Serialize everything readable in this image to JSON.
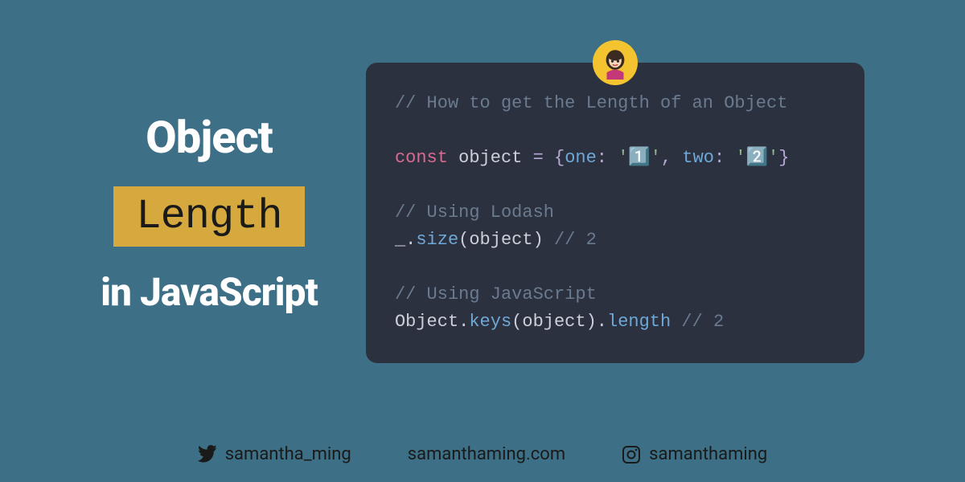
{
  "title": {
    "line1": "Object",
    "highlight": "Length",
    "line3": "in JavaScript"
  },
  "code": {
    "comment_title": "// How to get the Length of an Object",
    "const_kw": "const",
    "var_name": "object",
    "equals": " = ",
    "brace_open": "{",
    "key1": "one",
    "colon1": ": ",
    "val1": "'1️⃣'",
    "comma": ", ",
    "key2": "two",
    "colon2": ": ",
    "val2": "'2️⃣'",
    "brace_close": "}",
    "comment_lodash": "// Using Lodash",
    "lodash_prefix": "_.",
    "lodash_fn": "size",
    "lodash_args": "(object)",
    "lodash_result_comment": " // 2",
    "comment_js": "// Using JavaScript",
    "js_obj": "Object",
    "js_dot1": ".",
    "js_keys": "keys",
    "js_args": "(object)",
    "js_dot2": ".",
    "js_len": "length",
    "js_result_comment": " // 2"
  },
  "footer": {
    "twitter": "samantha_ming",
    "website": "samanthaming.com",
    "instagram": "samanthaming"
  }
}
